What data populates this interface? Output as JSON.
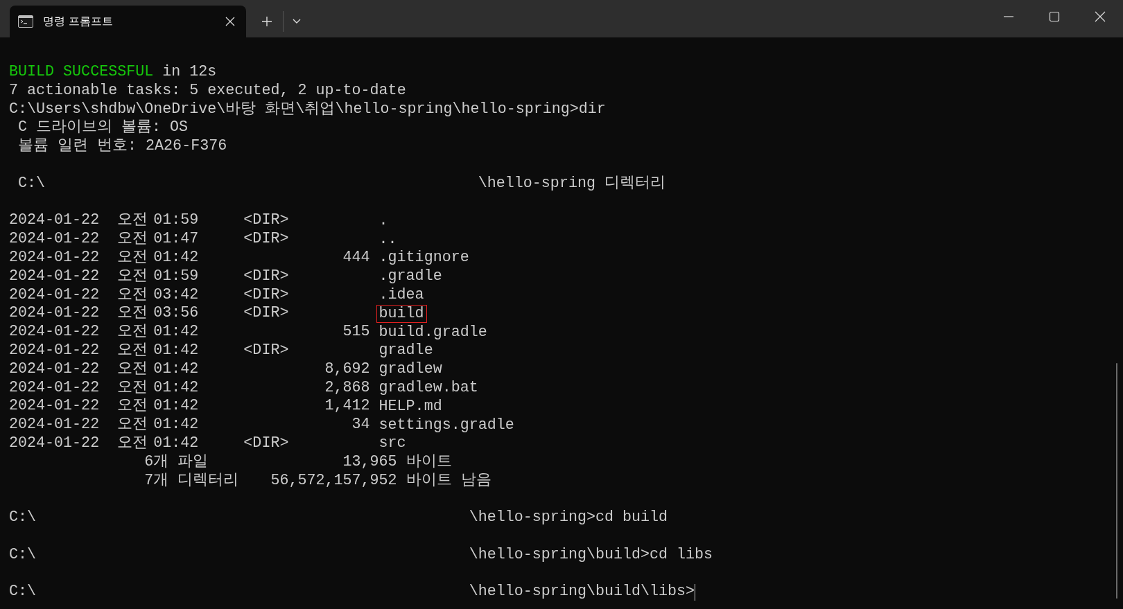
{
  "tab": {
    "title": "명령 프롬프트"
  },
  "terminal": {
    "lines": [
      {
        "kind": "status",
        "status": "BUILD SUCCESSFUL",
        "text": " in 12s"
      },
      {
        "kind": "text",
        "text": "7 actionable tasks: 5 executed, 2 up-to-date"
      },
      {
        "kind": "text",
        "text": "C:\\Users\\shdbw\\OneDrive\\바탕 화면\\취업\\hello-spring\\hello-spring>dir"
      },
      {
        "kind": "text",
        "text": " C 드라이브의 볼륨: OS"
      },
      {
        "kind": "text",
        "text": " 볼륨 일련 번호: 2A26-F376"
      },
      {
        "kind": "blank"
      },
      {
        "kind": "heading",
        "left": " C:\\",
        "right": "\\hello-spring 디렉터리"
      },
      {
        "kind": "blank"
      },
      {
        "kind": "entry",
        "date": "2024-01-22",
        "period": "오전",
        "time": "01:59",
        "dir": "<DIR>",
        "name": ".",
        "highlighted": false
      },
      {
        "kind": "entry",
        "date": "2024-01-22",
        "period": "오전",
        "time": "01:47",
        "dir": "<DIR>",
        "name": "..",
        "highlighted": false
      },
      {
        "kind": "entry",
        "date": "2024-01-22",
        "period": "오전",
        "time": "01:42",
        "size": "444",
        "name": ".gitignore",
        "highlighted": false
      },
      {
        "kind": "entry",
        "date": "2024-01-22",
        "period": "오전",
        "time": "01:59",
        "dir": "<DIR>",
        "name": ".gradle",
        "highlighted": false
      },
      {
        "kind": "entry",
        "date": "2024-01-22",
        "period": "오전",
        "time": "03:42",
        "dir": "<DIR>",
        "name": ".idea",
        "highlighted": false
      },
      {
        "kind": "entry",
        "date": "2024-01-22",
        "period": "오전",
        "time": "03:56",
        "dir": "<DIR>",
        "name": "build",
        "highlighted": true
      },
      {
        "kind": "entry",
        "date": "2024-01-22",
        "period": "오전",
        "time": "01:42",
        "size": "515",
        "name": "build.gradle",
        "highlighted": false
      },
      {
        "kind": "entry",
        "date": "2024-01-22",
        "period": "오전",
        "time": "01:42",
        "dir": "<DIR>",
        "name": "gradle",
        "highlighted": false
      },
      {
        "kind": "entry",
        "date": "2024-01-22",
        "period": "오전",
        "time": "01:42",
        "size": "8,692",
        "name": "gradlew",
        "highlighted": false
      },
      {
        "kind": "entry",
        "date": "2024-01-22",
        "period": "오전",
        "time": "01:42",
        "size": "2,868",
        "name": "gradlew.bat",
        "highlighted": false
      },
      {
        "kind": "entry",
        "date": "2024-01-22",
        "period": "오전",
        "time": "01:42",
        "size": "1,412",
        "name": "HELP.md",
        "highlighted": false
      },
      {
        "kind": "entry",
        "date": "2024-01-22",
        "period": "오전",
        "time": "01:42",
        "size": "34",
        "name": "settings.gradle",
        "highlighted": false
      },
      {
        "kind": "entry",
        "date": "2024-01-22",
        "period": "오전",
        "time": "01:42",
        "dir": "<DIR>",
        "name": "src",
        "highlighted": false
      },
      {
        "kind": "summary",
        "label": "6개 파일",
        "number": "13,965",
        "unit": "바이트"
      },
      {
        "kind": "summary",
        "label": "7개 디렉터리",
        "number": "56,572,157,952",
        "unit": "바이트 남음"
      },
      {
        "kind": "blank"
      },
      {
        "kind": "prompt",
        "left": "C:\\",
        "right": "\\hello-spring>cd build",
        "cursor": false
      },
      {
        "kind": "blank"
      },
      {
        "kind": "prompt",
        "left": "C:\\",
        "right": "\\hello-spring\\build>cd libs",
        "cursor": false
      },
      {
        "kind": "blank"
      },
      {
        "kind": "prompt",
        "left": "C:\\",
        "right": "\\hello-spring\\build\\libs>",
        "cursor": true
      }
    ]
  }
}
